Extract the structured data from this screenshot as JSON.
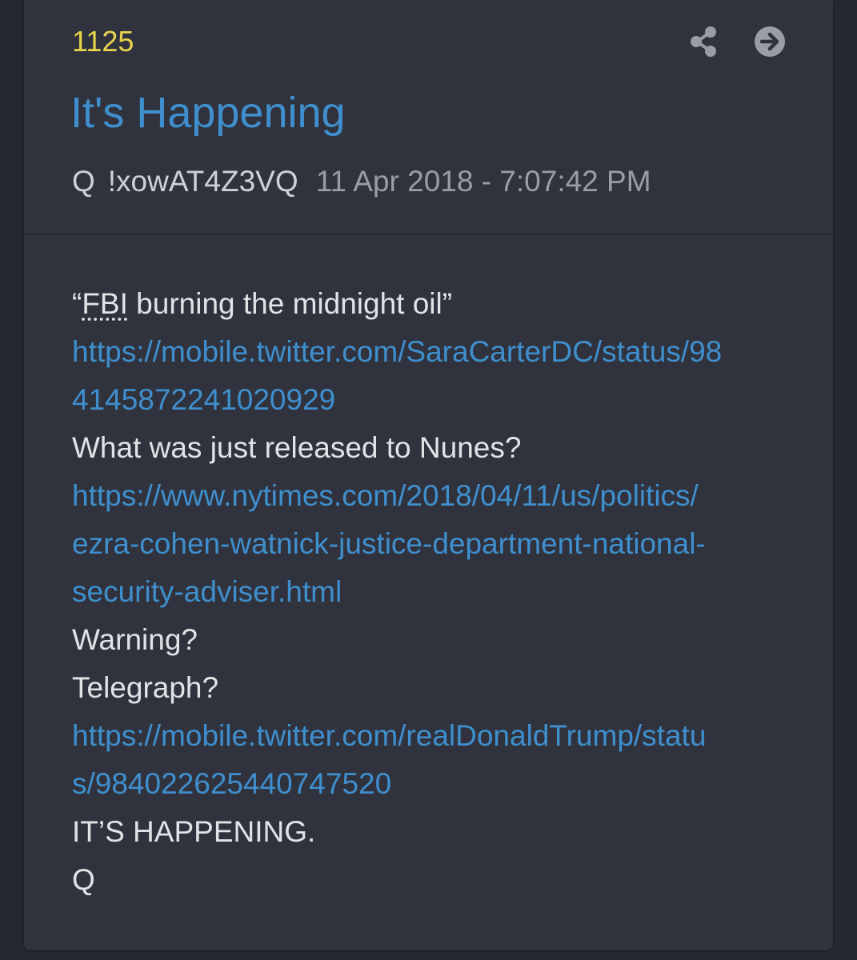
{
  "post": {
    "number": "1125",
    "title": "It's Happening",
    "author": "Q",
    "tripcode": "!xowAT4Z3VQ",
    "timestamp": "11 Apr 2018 - 7:07:42 PM",
    "actions": [
      {
        "icon": "share-icon"
      },
      {
        "icon": "arrow-right-circle-icon"
      }
    ],
    "body": {
      "quote_open": "“",
      "quote_abbr": "FBI",
      "quote_rest": " burning the midnight oil”",
      "link1_line1": "https://mobile.twitter.com/SaraCarterDC/status/98",
      "link1_line2": "4145872241020929",
      "question1": "What was just released to Nunes?",
      "link2_line1": "https://www.nytimes.com/2018/04/11/us/politics/",
      "link2_line2": "ezra-cohen-watnick-justice-department-national-",
      "link2_line3": "security-adviser.html",
      "question2": "Warning?",
      "question3": "Telegraph?",
      "link3_line1": "https://mobile.twitter.com/realDonaldTrump/statu",
      "link3_line2": "s/984022625440747520",
      "statement": "IT’S HAPPENING.",
      "signature": "Q"
    }
  },
  "colors": {
    "background": "#252830",
    "card": "#30333d",
    "post_number": "#e8d44d",
    "link": "#3f8fce",
    "text": "#e2e3e6",
    "timestamp": "#9a9da5"
  }
}
